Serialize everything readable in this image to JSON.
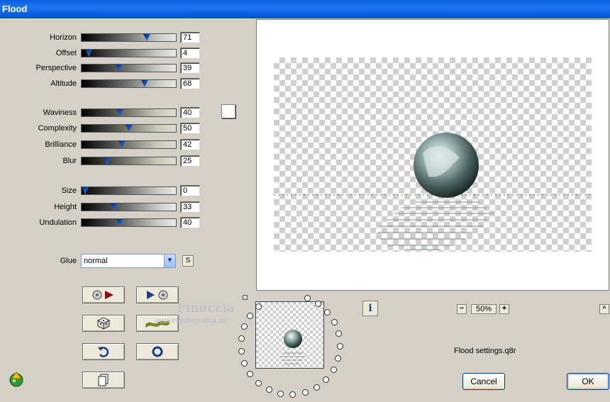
{
  "window": {
    "title": "Flood"
  },
  "sliders": [
    {
      "label": "Horizon",
      "value": "71",
      "fraction": 0.71
    },
    {
      "label": "Offset",
      "value": "4",
      "fraction": 0.04
    },
    {
      "label": "Perspective",
      "value": "39",
      "fraction": 0.39
    },
    {
      "label": "Altitude",
      "value": "68",
      "fraction": 0.68
    },
    {
      "label": "Waviness",
      "value": "40",
      "fraction": 0.4
    },
    {
      "label": "Complexity",
      "value": "50",
      "fraction": 0.5
    },
    {
      "label": "Brilliance",
      "value": "42",
      "fraction": 0.42
    },
    {
      "label": "Blur",
      "value": "25",
      "fraction": 0.25
    },
    {
      "label": "Size",
      "value": "0",
      "fraction": 0.0
    },
    {
      "label": "Height",
      "value": "33",
      "fraction": 0.33
    },
    {
      "label": "Undulation",
      "value": "40",
      "fraction": 0.4
    }
  ],
  "glue": {
    "label": "Glue",
    "value": "normal",
    "lock_label": "S"
  },
  "icon_buttons": [
    "load-preset-icon",
    "save-preset-icon",
    "random-dice-icon",
    "brush-icon",
    "undo-icon",
    "reset-icon",
    "copy-icon"
  ],
  "watermark": {
    "name": "Pinuccia",
    "url": "www.maidiregrafica.eu"
  },
  "zoom": {
    "minus": "−",
    "value": "50%",
    "plus": "+",
    "info": "i",
    "collapse": "^"
  },
  "settings_file": "Flood settings.q8r",
  "buttons": {
    "cancel": "Cancel",
    "ok": "OK"
  },
  "colors": {
    "titlebar": "#0a5fe0",
    "dialog": "#d4d0c8"
  }
}
